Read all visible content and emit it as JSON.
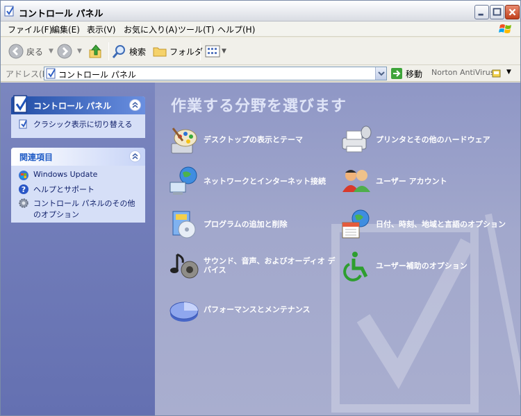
{
  "window": {
    "title": "コントロール パネル"
  },
  "menu": {
    "items": [
      "ファイル(F)",
      "編集(E)",
      "表示(V)",
      "お気に入り(A)",
      "ツール(T)",
      "ヘルプ(H)"
    ]
  },
  "toolbar": {
    "back": "戻る",
    "search": "検索",
    "folders": "フォルダ"
  },
  "address": {
    "label": "アドレス(D)",
    "value": "コントロール パネル",
    "go": "移動",
    "norton": "Norton AntiVirus"
  },
  "left_pane": {
    "cp_panel": {
      "title": "コントロール パネル",
      "link": "クラシック表示に切り替える"
    },
    "related": {
      "title": "関連項目",
      "links": [
        "Windows Update",
        "ヘルプとサポート",
        "コントロール パネルのその他のオプション"
      ]
    }
  },
  "main": {
    "heading": "作業する分野を選びます",
    "categories": [
      "デスクトップの表示とテーマ",
      "プリンタとその他のハードウェア",
      "ネットワークとインターネット接続",
      "ユーザー アカウント",
      "プログラムの追加と削除",
      "日付、時刻、地域と言語のオプション",
      "サウンド、音声、およびオーディオ デバイス",
      "ユーザー補助のオプション",
      "パフォーマンスとメンテナンス"
    ]
  }
}
